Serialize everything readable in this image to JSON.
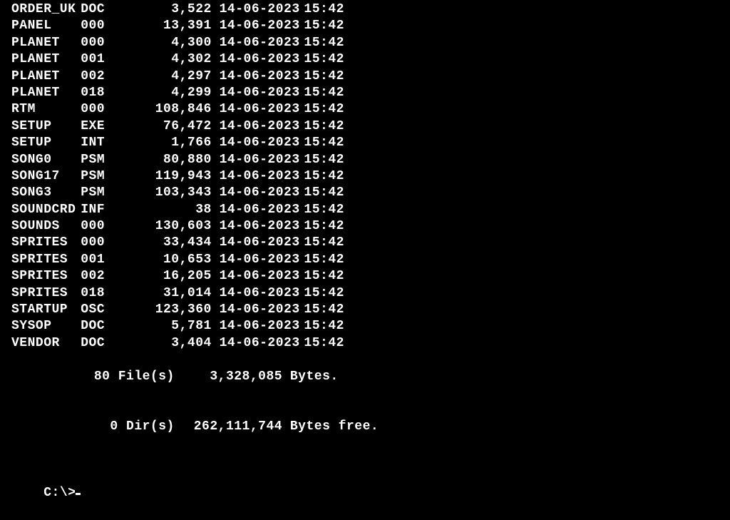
{
  "files": [
    {
      "name": "ORDER_UK",
      "ext": "DOC",
      "size": "3,522",
      "date": "14-06-2023",
      "time": "15:42"
    },
    {
      "name": "PANEL",
      "ext": "000",
      "size": "13,391",
      "date": "14-06-2023",
      "time": "15:42"
    },
    {
      "name": "PLANET",
      "ext": "000",
      "size": "4,300",
      "date": "14-06-2023",
      "time": "15:42"
    },
    {
      "name": "PLANET",
      "ext": "001",
      "size": "4,302",
      "date": "14-06-2023",
      "time": "15:42"
    },
    {
      "name": "PLANET",
      "ext": "002",
      "size": "4,297",
      "date": "14-06-2023",
      "time": "15:42"
    },
    {
      "name": "PLANET",
      "ext": "018",
      "size": "4,299",
      "date": "14-06-2023",
      "time": "15:42"
    },
    {
      "name": "RTM",
      "ext": "000",
      "size": "108,846",
      "date": "14-06-2023",
      "time": "15:42"
    },
    {
      "name": "SETUP",
      "ext": "EXE",
      "size": "76,472",
      "date": "14-06-2023",
      "time": "15:42"
    },
    {
      "name": "SETUP",
      "ext": "INT",
      "size": "1,766",
      "date": "14-06-2023",
      "time": "15:42"
    },
    {
      "name": "SONG0",
      "ext": "PSM",
      "size": "80,880",
      "date": "14-06-2023",
      "time": "15:42"
    },
    {
      "name": "SONG17",
      "ext": "PSM",
      "size": "119,943",
      "date": "14-06-2023",
      "time": "15:42"
    },
    {
      "name": "SONG3",
      "ext": "PSM",
      "size": "103,343",
      "date": "14-06-2023",
      "time": "15:42"
    },
    {
      "name": "SOUNDCRD",
      "ext": "INF",
      "size": "38",
      "date": "14-06-2023",
      "time": "15:42"
    },
    {
      "name": "SOUNDS",
      "ext": "000",
      "size": "130,603",
      "date": "14-06-2023",
      "time": "15:42"
    },
    {
      "name": "SPRITES",
      "ext": "000",
      "size": "33,434",
      "date": "14-06-2023",
      "time": "15:42"
    },
    {
      "name": "SPRITES",
      "ext": "001",
      "size": "10,653",
      "date": "14-06-2023",
      "time": "15:42"
    },
    {
      "name": "SPRITES",
      "ext": "002",
      "size": "16,205",
      "date": "14-06-2023",
      "time": "15:42"
    },
    {
      "name": "SPRITES",
      "ext": "018",
      "size": "31,014",
      "date": "14-06-2023",
      "time": "15:42"
    },
    {
      "name": "STARTUP",
      "ext": "OSC",
      "size": "123,360",
      "date": "14-06-2023",
      "time": "15:42"
    },
    {
      "name": "SYSOP",
      "ext": "DOC",
      "size": "5,781",
      "date": "14-06-2023",
      "time": "15:42"
    },
    {
      "name": "VENDOR",
      "ext": "DOC",
      "size": "3,404",
      "date": "14-06-2023",
      "time": "15:42"
    }
  ],
  "summary": {
    "files_count_label": "80 File(s)",
    "files_bytes": "3,328,085",
    "files_bytes_suffix": "Bytes.",
    "dirs_count_label": "0 Dir(s)",
    "dirs_bytes": "262,111,744",
    "dirs_bytes_suffix": "Bytes free."
  },
  "prompt": "C:\\>"
}
